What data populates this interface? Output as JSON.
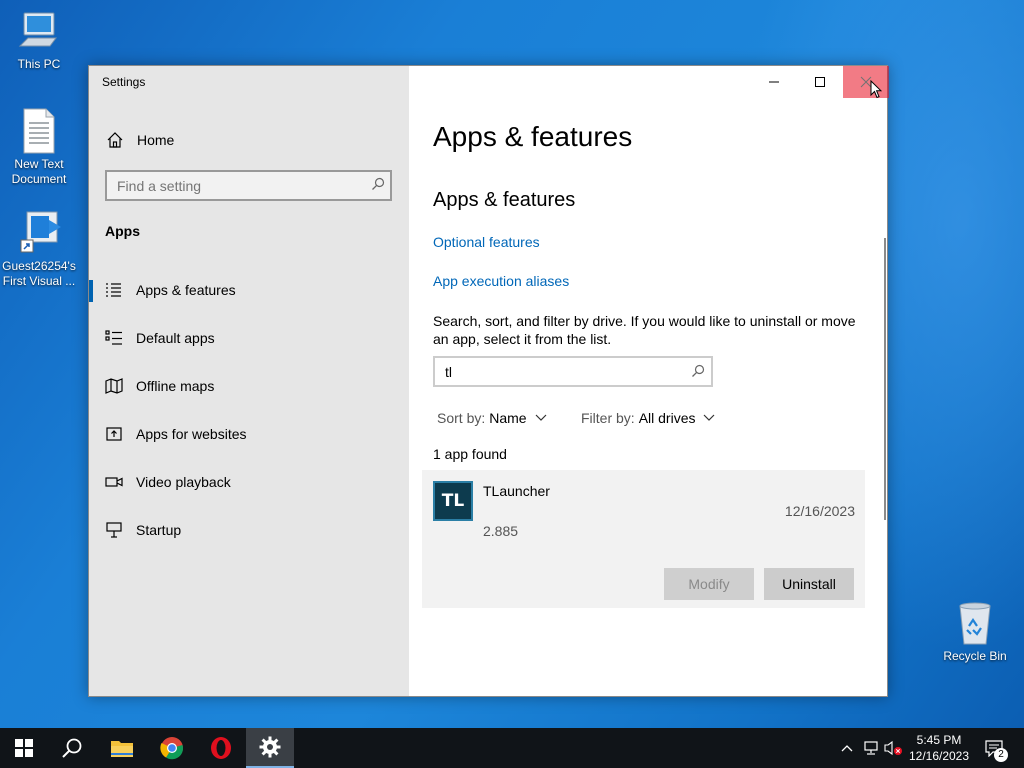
{
  "desktop": {
    "icons": [
      {
        "label": "This PC"
      },
      {
        "label": "New Text Document"
      },
      {
        "label": "Guest26254's First Visual ..."
      },
      {
        "label": "Recycle Bin"
      }
    ]
  },
  "window": {
    "title": "Settings",
    "sidebar": {
      "home_label": "Home",
      "search_placeholder": "Find a setting",
      "section_label": "Apps",
      "items": [
        {
          "label": "Apps & features",
          "icon": "list-icon",
          "active": true
        },
        {
          "label": "Default apps",
          "icon": "default-apps-icon"
        },
        {
          "label": "Offline maps",
          "icon": "map-icon"
        },
        {
          "label": "Apps for websites",
          "icon": "web-app-icon"
        },
        {
          "label": "Video playback",
          "icon": "video-icon"
        },
        {
          "label": "Startup",
          "icon": "startup-icon"
        }
      ]
    },
    "main": {
      "page_title": "Apps & features",
      "section_title": "Apps & features",
      "link_optional": "Optional features",
      "link_aliases": "App execution aliases",
      "description": "Search, sort, and filter by drive. If you would like to uninstall or move an app, select it from the list.",
      "search_value": "tl",
      "sort_label": "Sort by:",
      "sort_value": "Name",
      "filter_label": "Filter by:",
      "filter_value": "All drives",
      "found_text": "1 app found",
      "app": {
        "logo_text": "TL",
        "name": "TLauncher",
        "date": "12/16/2023",
        "version": "2.885",
        "modify_label": "Modify",
        "uninstall_label": "Uninstall"
      }
    }
  },
  "taskbar": {
    "time": "5:45 PM",
    "date": "12/16/2023",
    "notification_count": "2"
  },
  "colors": {
    "accent": "#0063b1",
    "link": "#0067b8",
    "taskbar": "#101418"
  }
}
